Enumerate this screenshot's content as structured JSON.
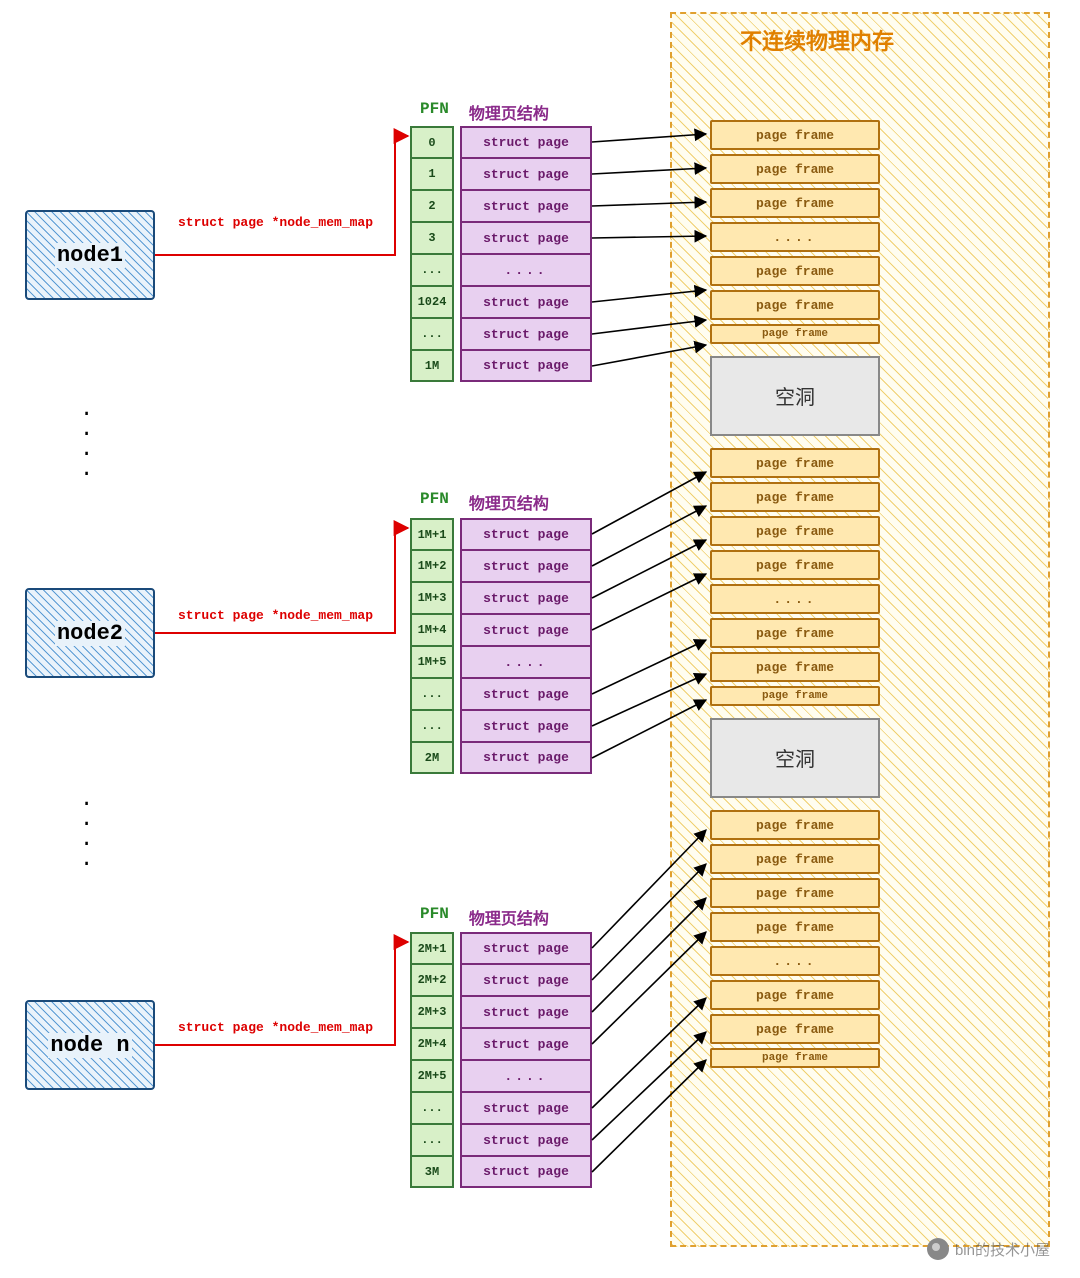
{
  "mem_title": "不连续物理内存",
  "nodes": [
    "node1",
    "node2",
    "node  n"
  ],
  "ptr_label": "struct page *node_mem_map",
  "col_headers": {
    "pfn": "PFN",
    "phys": "物理页结构"
  },
  "table1_pfn": [
    "0",
    "1",
    "2",
    "3",
    "...",
    "1024",
    "...",
    "1M"
  ],
  "table1_sp": [
    "struct page",
    "struct page",
    "struct page",
    "struct page",
    "....",
    "struct page",
    "struct page",
    "struct page"
  ],
  "table2_pfn": [
    "1M+1",
    "1M+2",
    "1M+3",
    "1M+4",
    "1M+5",
    "...",
    "...",
    "2M"
  ],
  "table2_sp": [
    "struct page",
    "struct page",
    "struct page",
    "struct page",
    "....",
    "struct page",
    "struct page",
    "struct page"
  ],
  "table3_pfn": [
    "2M+1",
    "2M+2",
    "2M+3",
    "2M+4",
    "2M+5",
    "...",
    "...",
    "3M"
  ],
  "table3_sp": [
    "struct page",
    "struct page",
    "struct page",
    "struct page",
    "....",
    "struct page",
    "struct page",
    "struct page"
  ],
  "mem_items": [
    "page frame",
    "page frame",
    "page frame",
    "....",
    "page frame",
    "page frame",
    "page frame",
    "空洞",
    "page frame",
    "page frame",
    "page frame",
    "page frame",
    "....",
    "page frame",
    "page frame",
    "page frame",
    "空洞",
    "page frame",
    "page frame",
    "page frame",
    "page frame",
    "....",
    "page frame",
    "page frame",
    "page frame"
  ],
  "mem_short_idx": [
    6,
    15,
    24
  ],
  "hole_text": "空洞",
  "watermark": "bin的技术小屋"
}
